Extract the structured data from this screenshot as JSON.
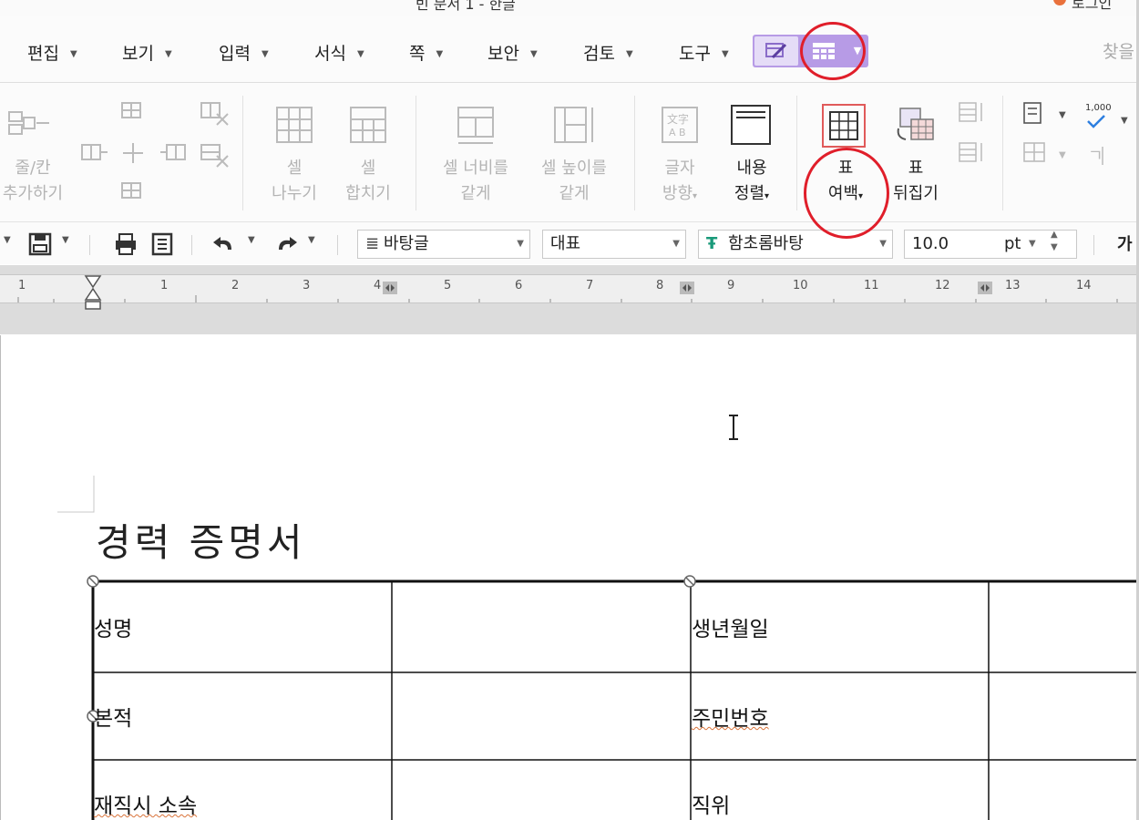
{
  "window": {
    "title_fragment": "빈 문서 1 - 한글",
    "right_fragment": "로그인"
  },
  "menubar": {
    "items": [
      {
        "label": "편집"
      },
      {
        "label": "보기"
      },
      {
        "label": "입력"
      },
      {
        "label": "서식"
      },
      {
        "label": "쪽"
      },
      {
        "label": "보안"
      },
      {
        "label": "검토"
      },
      {
        "label": "도구"
      }
    ],
    "search_label": "찾을"
  },
  "ribbon": {
    "row_col": {
      "label_line1": "줄/칸",
      "label_line2": "추가하기"
    },
    "split_cell": {
      "label_line1": "셀",
      "label_line2": "나누기"
    },
    "merge_cell": {
      "label_line1": "셀",
      "label_line2": "합치기"
    },
    "equal_width": {
      "label_line1": "셀 너비를",
      "label_line2": "같게"
    },
    "equal_height": {
      "label_line1": "셀 높이를",
      "label_line2": "같게"
    },
    "text_direction": {
      "label_line1": "글자",
      "label_line2": "방향"
    },
    "content_align": {
      "label_line1": "내용",
      "label_line2": "정렬"
    },
    "table_margin": {
      "label_line1": "표",
      "label_line2": "여백"
    },
    "table_flip": {
      "label_line1": "표",
      "label_line2": "뒤집기"
    },
    "number_format": "1,000"
  },
  "toolbar": {
    "style": "바탕글",
    "language": "대표",
    "font": "함초롬바탕",
    "font_size": "10.0",
    "unit": "pt",
    "bold_fragment": "가"
  },
  "ruler": {
    "numbers": [
      "1",
      "1",
      "2",
      "3",
      "4",
      "5",
      "6",
      "7",
      "8",
      "9",
      "10",
      "11",
      "12",
      "13",
      "14"
    ]
  },
  "document": {
    "title": "경력 증명서",
    "table": {
      "rows": [
        {
          "label_left": "성명",
          "label_right": "생년월일"
        },
        {
          "label_left": "본적",
          "label_right": "주민번호"
        },
        {
          "label_left": "재직시 소속",
          "label_right": "직위"
        }
      ]
    }
  },
  "colors": {
    "accent": "#b79be6",
    "highlight_circle": "#e01e2a",
    "spell_underline": "#d9733a"
  }
}
